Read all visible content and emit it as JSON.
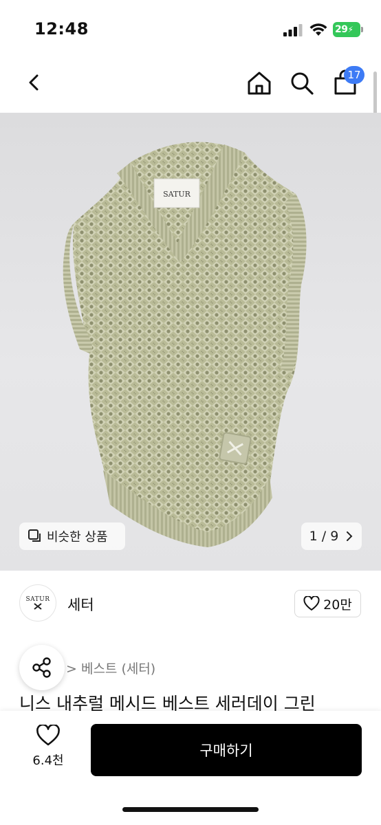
{
  "status_bar": {
    "time": "12:48",
    "battery_level": "29",
    "icons": [
      "signal-icon",
      "wifi-icon",
      "battery-charging-icon"
    ]
  },
  "nav": {
    "icons": [
      "back-chevron-icon",
      "home-icon",
      "search-icon",
      "shopping-bag-icon"
    ],
    "cart_badge": "17",
    "badge_color": "#3d7bf5"
  },
  "product_image": {
    "label_text": "SATUR",
    "similar_label": "비슷한 상품",
    "page_counter": "1 / 9",
    "page_current": 1,
    "page_total": 9
  },
  "shop": {
    "logo_text": "SATUR",
    "name": "세터",
    "like_count": "20만"
  },
  "product": {
    "breadcrumb": "> 베스트 (세터)",
    "title": "니스 내추럴 메시드 베스트 세러데이 그린"
  },
  "bottom_bar": {
    "wish_count": "6.4천",
    "buy_label": "구매하기"
  },
  "colors": {
    "buy_button": "#000000",
    "battery": "#34c759",
    "image_background": "#e3e3e5"
  }
}
